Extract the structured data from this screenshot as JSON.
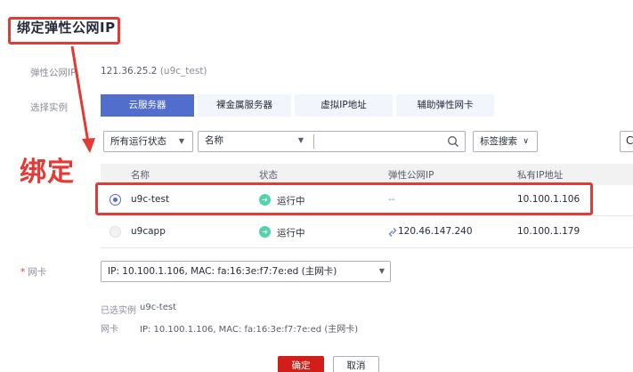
{
  "dialog": {
    "title": "绑定弹性公网IP"
  },
  "eip": {
    "label": "弹性公网IP",
    "value": "121.36.25.2",
    "name": "(u9c_test)"
  },
  "instance_type": {
    "label": "选择实例",
    "tabs": [
      {
        "label": "云服务器",
        "active": true
      },
      {
        "label": "裸金属服务器",
        "active": false
      },
      {
        "label": "虚拟IP地址",
        "active": false
      },
      {
        "label": "辅助弹性网卡",
        "active": false
      }
    ]
  },
  "filter": {
    "status_select": "所有运行状态",
    "field_select": "名称",
    "tag_search": "标签搜索",
    "tag_search_chevron": "∨",
    "refresh_glyph": "C"
  },
  "annotation": {
    "text": "绑定",
    "color": "#e53935"
  },
  "table": {
    "columns": [
      "名称",
      "状态",
      "弹性公网IP",
      "私有IP地址"
    ],
    "rows": [
      {
        "name": "u9c-test",
        "status": "运行中",
        "eip": "--",
        "private_ip": "10.100.1.106",
        "selected": true
      },
      {
        "name": "u9capp",
        "status": "运行中",
        "eip": "120.46.147.240",
        "private_ip": "10.100.1.179",
        "selected": false
      }
    ]
  },
  "nic": {
    "label": "网卡",
    "required_mark": "*",
    "value": "IP: 10.100.1.106, MAC: fa:16:3e:f7:7e:ed (主网卡)"
  },
  "summary": {
    "instance_label": "已选实例",
    "instance_value": "u9c-test",
    "nic_label": "网卡",
    "nic_value": "IP: 10.100.1.106, MAC: fa:16:3e:f7:7e:ed (主网卡)"
  },
  "buttons": {
    "ok": "确定",
    "cancel": "取消"
  },
  "colors": {
    "accent": "#526ecc",
    "primary_button": "#d21e18",
    "running": "#50d4ab",
    "annotation": "#e53935"
  }
}
